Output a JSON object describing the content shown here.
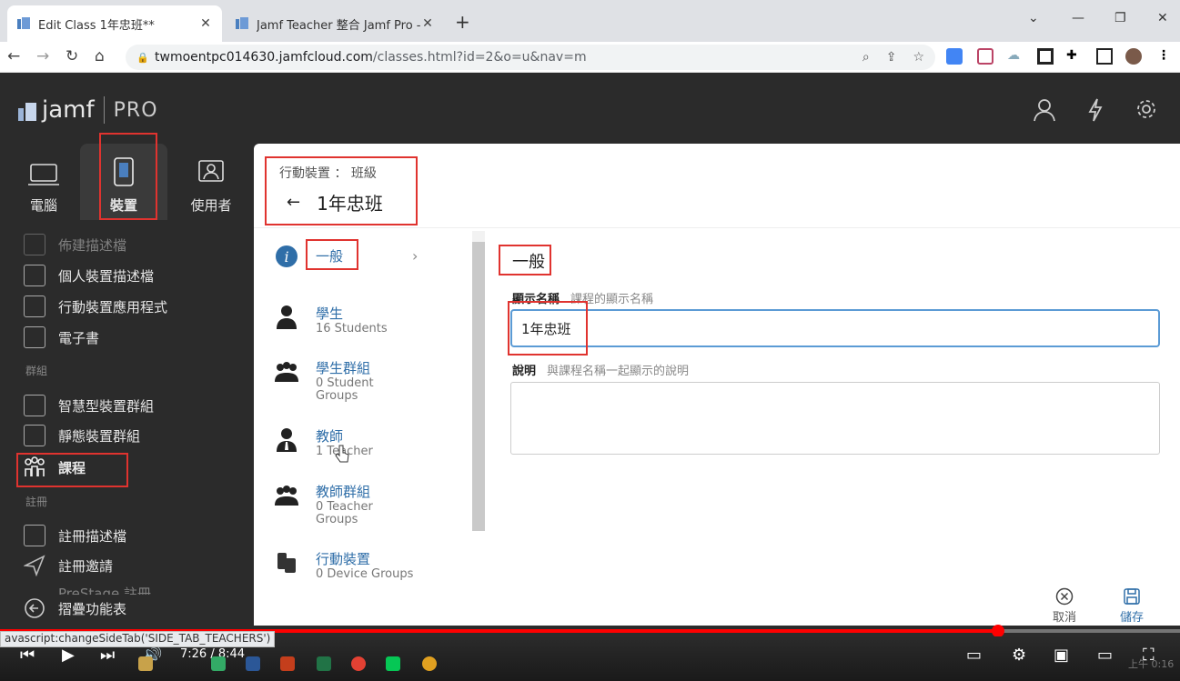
{
  "browser": {
    "tabs": [
      {
        "title": "Edit Class 1年忠班**",
        "active": true
      },
      {
        "title": "Jamf Teacher 整合 Jamf Pro - Ja",
        "active": false
      }
    ],
    "new_tab": "+",
    "url_host": "twmoentpc014630.jamfcloud.com",
    "url_path": "/classes.html?id=2&o=u&nav=m"
  },
  "header": {
    "logo_text": "jamf",
    "logo_pro": "PRO"
  },
  "sidebar": {
    "categories": [
      {
        "label": "電腦",
        "selected": false
      },
      {
        "label": "裝置",
        "selected": true
      },
      {
        "label": "使用者",
        "selected": false
      }
    ],
    "items": [
      {
        "label": "佈建描述檔",
        "faded": true
      },
      {
        "label": "個人裝置描述檔"
      },
      {
        "label": "行動裝置應用程式"
      },
      {
        "label": "電子書"
      },
      {
        "label": "智慧型裝置群組"
      },
      {
        "label": "靜態裝置群組"
      },
      {
        "label": "課程",
        "selected": true
      },
      {
        "label": "註冊描述檔"
      },
      {
        "label": "註冊邀請"
      },
      {
        "label": "PreStage 註冊",
        "faded": true
      }
    ],
    "headings": {
      "groups": "群組",
      "enroll": "註冊"
    },
    "collapse_label": "摺疊功能表"
  },
  "main": {
    "breadcrumb": "行動裝置 ： 班級",
    "title": "1年忠班",
    "side_tabs": [
      {
        "label": "一般",
        "sub": ""
      },
      {
        "label": "學生",
        "sub": "16 Students"
      },
      {
        "label": "學生群組",
        "sub": "0 Student Groups"
      },
      {
        "label": "教師",
        "sub": "1 Teacher"
      },
      {
        "label": "教師群組",
        "sub": "0 Teacher Groups"
      },
      {
        "label": "行動裝置",
        "sub": "0 Device Groups"
      }
    ],
    "section_title": "一般",
    "display_name_label": "顯示名稱",
    "display_name_hint": "課程的顯示名稱",
    "display_name_value": "1年忠班",
    "description_label": "說明",
    "description_hint": "與課程名稱一起顯示的說明",
    "cancel_label": "取消",
    "save_label": "儲存"
  },
  "video": {
    "status_text": "avascript:changeSideTab('SIDE_TAB_TEACHERS')",
    "time": "7:26 / 8:44",
    "progress": 0.846,
    "clock_text": "上午 0:16"
  },
  "colors": {
    "accent": "#2f6ea8",
    "highlight_box": "#e0332f",
    "dark_bg": "#2b2b2b",
    "progress": "#ff0000"
  }
}
